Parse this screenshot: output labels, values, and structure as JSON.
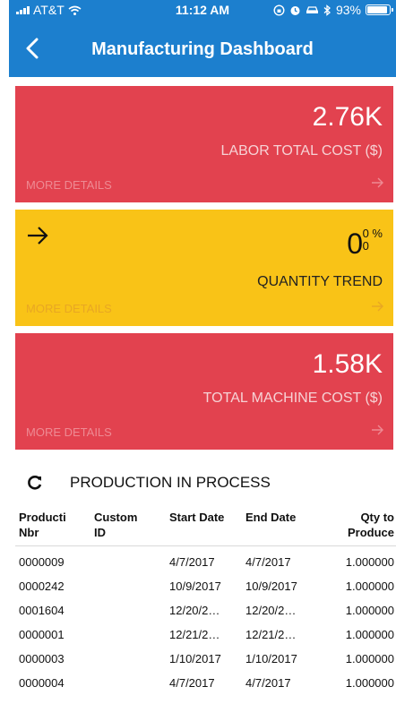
{
  "status_bar": {
    "carrier": "AT&T",
    "time": "11:12 AM",
    "battery": "93%",
    "battery_level": 0.93,
    "icons": [
      "signal-icon",
      "wifi-icon",
      "lock-rotation-icon",
      "alarm-icon",
      "car-icon",
      "bluetooth-icon",
      "battery-icon"
    ]
  },
  "nav": {
    "title": "Manufacturing Dashboard"
  },
  "tiles": {
    "labor": {
      "value": "2.76K",
      "label": "LABOR TOTAL COST ($)",
      "more": "MORE DETAILS"
    },
    "quantity": {
      "value": "0",
      "pct": "0 %",
      "pct_sub": "0",
      "label": "QUANTITY TREND",
      "more": "MORE DETAILS"
    },
    "machine": {
      "value": "1.58K",
      "label": "TOTAL MACHINE COST ($)",
      "more": "MORE DETAILS"
    }
  },
  "colors": {
    "nav": "#1c7fce",
    "red_tile": "#e2424f",
    "yellow_tile": "#f9c317"
  },
  "production": {
    "title": "PRODUCTION IN PROCESS",
    "headers": {
      "c1": "Producti Nbr",
      "c2": "Custom ID",
      "c3": "Start Date",
      "c4": "End Date",
      "c5": "Qty to Produce"
    },
    "rows": [
      [
        "0000009",
        "",
        "4/7/2017",
        "4/7/2017",
        "1.000000"
      ],
      [
        "0000242",
        "",
        "10/9/2017",
        "10/9/2017",
        "1.000000"
      ],
      [
        "0001604",
        "",
        "12/20/2…",
        "12/20/2…",
        "1.000000"
      ],
      [
        "0000001",
        "",
        "12/21/2…",
        "12/21/2…",
        "1.000000"
      ],
      [
        "0000003",
        "",
        "1/10/2017",
        "1/10/2017",
        "1.000000"
      ],
      [
        "0000004",
        "",
        "4/7/2017",
        "4/7/2017",
        "1.000000"
      ]
    ]
  }
}
